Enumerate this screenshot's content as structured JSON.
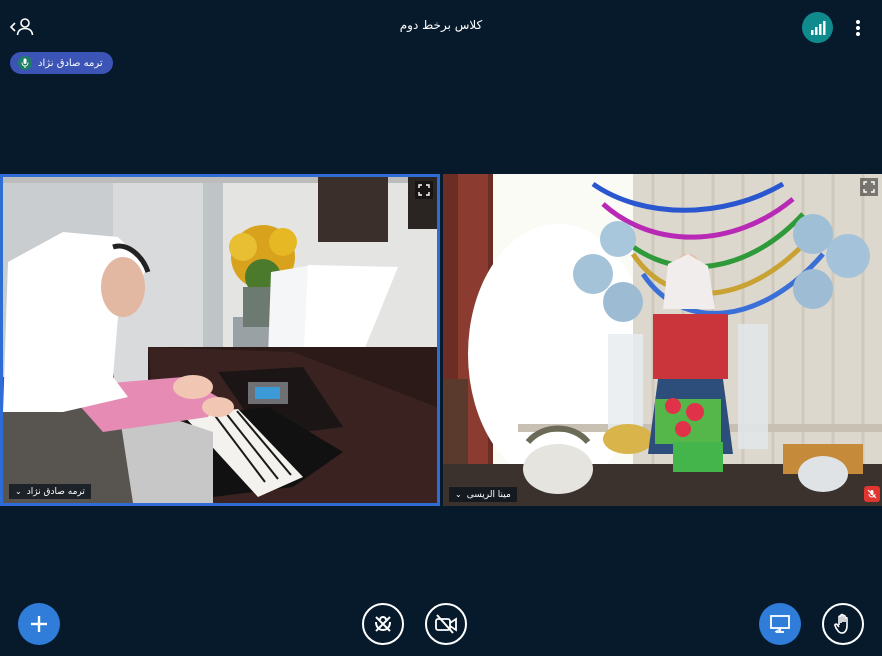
{
  "header": {
    "title": "کلاس برخط دوم"
  },
  "talking_indicator": {
    "name": "ترمه صادق نژاد"
  },
  "videos": [
    {
      "name": "ترمه صادق نژاد",
      "muted": false
    },
    {
      "name": "مینا الریسی",
      "muted": true
    }
  ],
  "icons": {
    "user_list": "user-icon",
    "connection": "signal-bars-icon",
    "more": "vertical-dots-icon",
    "fullscreen": "expand-icon",
    "add": "plus-icon",
    "audio": "mic-off-icon",
    "video": "camera-off-icon",
    "screenshare": "screen-share-icon",
    "raise_hand": "hand-icon"
  },
  "colors": {
    "background": "#061a2c",
    "accent_blue": "#2f7dd9",
    "connection_teal": "#0f8b8d",
    "talker_pill": "#3b54b6",
    "active_border": "#2e6cd6",
    "muted_red": "#e0362f"
  }
}
